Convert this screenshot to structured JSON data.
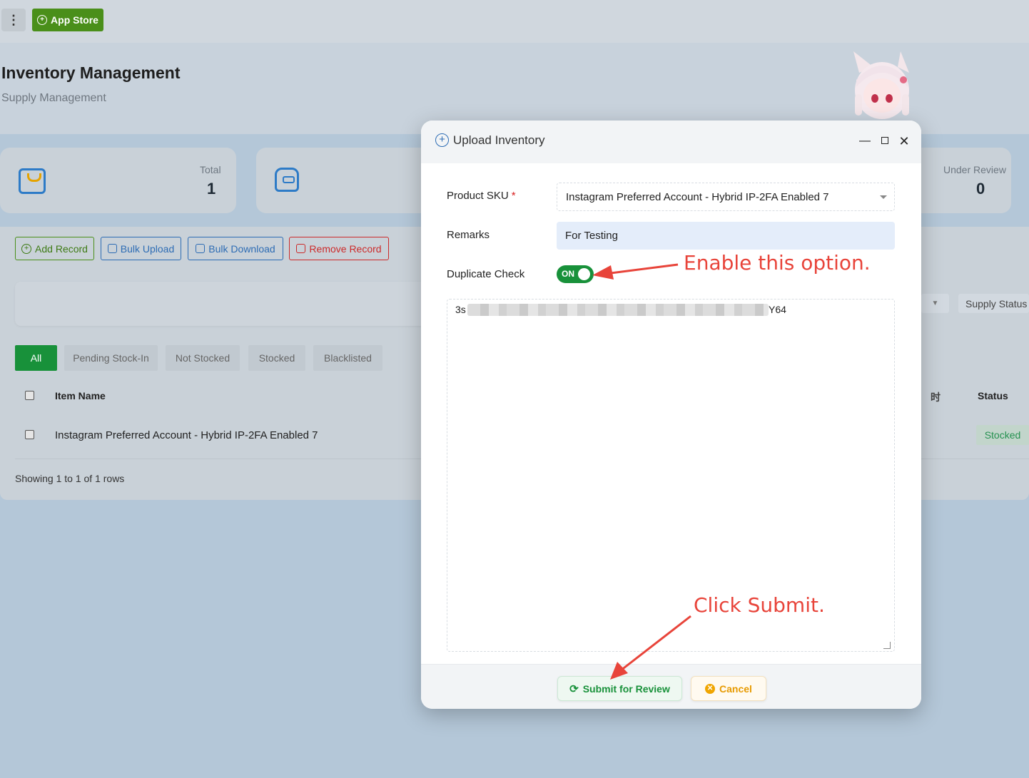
{
  "topbar": {
    "app_store_label": "App Store"
  },
  "header": {
    "title": "Inventory Management",
    "subtitle": "Supply Management"
  },
  "stats": {
    "total_label": "Total",
    "total_value": "1",
    "under_review_label": "Under Review",
    "under_review_value": "0"
  },
  "toolbar": {
    "add_record": "Add Record",
    "bulk_upload": "Bulk Upload",
    "bulk_download": "Bulk Download",
    "remove_record": "Remove Record"
  },
  "filters": {
    "supply_status": "Supply Status"
  },
  "tabs": [
    {
      "label": "All"
    },
    {
      "label": "Pending Stock-In"
    },
    {
      "label": "Not Stocked"
    },
    {
      "label": "Stocked"
    },
    {
      "label": "Blacklisted"
    }
  ],
  "table": {
    "columns": {
      "item_name": "Item Name",
      "partial": "时",
      "status": "Status"
    },
    "rows": [
      {
        "item_name": "Instagram Preferred Account - Hybrid IP-2FA Enabled 7",
        "status": "Stocked"
      }
    ],
    "showing": "Showing 1 to 1 of 1 rows"
  },
  "modal": {
    "title": "Upload Inventory",
    "product_sku_label": "Product SKU",
    "required_mark": "*",
    "product_sku_value": "Instagram Preferred Account - Hybrid IP-2FA Enabled 7",
    "remarks_label": "Remarks",
    "remarks_value": "For Testing",
    "duplicate_check_label": "Duplicate Check",
    "toggle_text": "ON",
    "inventory_prefix": "3s",
    "inventory_suffix": "Y64",
    "submit_label": "Submit for Review",
    "cancel_label": "Cancel"
  },
  "annotations": {
    "enable_note": "Enable this option.",
    "submit_note": "Click Submit.",
    "color": "#e8443a"
  },
  "colors": {
    "primary_green": "#18913a",
    "link_blue": "#2d6cb4",
    "danger_red": "#cc2a2a",
    "warning_orange": "#e79a00"
  }
}
